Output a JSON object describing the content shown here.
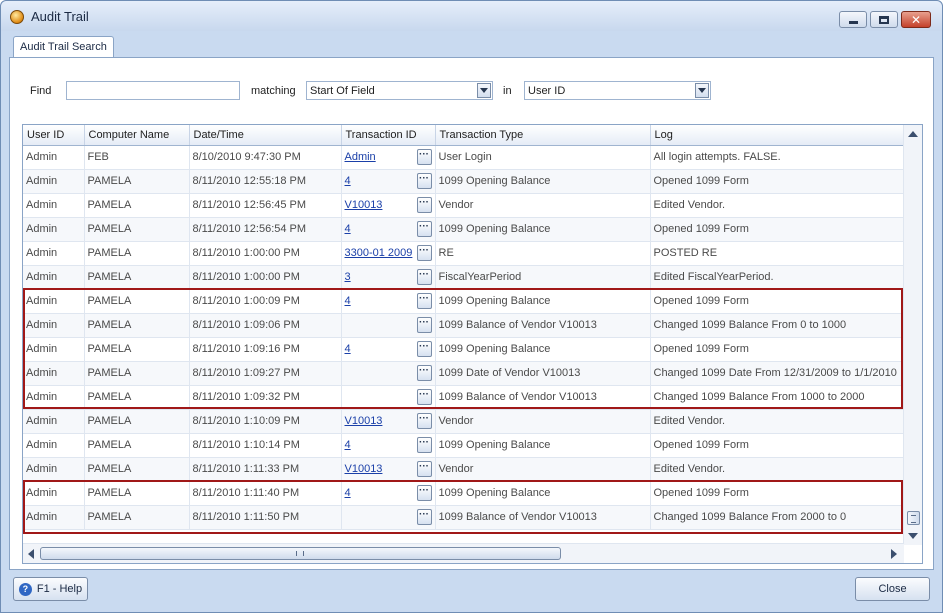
{
  "window": {
    "title": "Audit Trail"
  },
  "tabs": [
    {
      "label": "Audit Trail Search"
    }
  ],
  "search": {
    "find_label": "Find",
    "find_value": "",
    "matching_label": "matching",
    "matching_value": "Start Of Field",
    "in_label": "in",
    "in_value": "User ID"
  },
  "grid": {
    "columns": [
      "User ID",
      "Computer Name",
      "Date/Time",
      "Transaction ID",
      "Transaction Type",
      "Log"
    ],
    "rows": [
      {
        "user": "Admin",
        "computer": "FEB",
        "datetime": "8/10/2010 9:47:30 PM",
        "txid": "Admin",
        "type": "User Login",
        "log": "All login attempts. FALSE."
      },
      {
        "user": "Admin",
        "computer": "PAMELA",
        "datetime": "8/11/2010 12:55:18 PM",
        "txid": "4",
        "type": "1099 Opening Balance",
        "log": "Opened 1099 Form"
      },
      {
        "user": "Admin",
        "computer": "PAMELA",
        "datetime": "8/11/2010 12:56:45 PM",
        "txid": "V10013",
        "type": "Vendor",
        "log": "Edited Vendor."
      },
      {
        "user": "Admin",
        "computer": "PAMELA",
        "datetime": "8/11/2010 12:56:54 PM",
        "txid": "4",
        "type": "1099 Opening Balance",
        "log": "Opened 1099 Form"
      },
      {
        "user": "Admin",
        "computer": "PAMELA",
        "datetime": "8/11/2010 1:00:00 PM",
        "txid": "3300-01 2009",
        "type": "RE",
        "log": "POSTED RE"
      },
      {
        "user": "Admin",
        "computer": "PAMELA",
        "datetime": "8/11/2010 1:00:00 PM",
        "txid": "3",
        "type": "FiscalYearPeriod",
        "log": "Edited FiscalYearPeriod."
      },
      {
        "user": "Admin",
        "computer": "PAMELA",
        "datetime": "8/11/2010 1:00:09 PM",
        "txid": "4",
        "type": "1099 Opening Balance",
        "log": "Opened 1099 Form"
      },
      {
        "user": "Admin",
        "computer": "PAMELA",
        "datetime": "8/11/2010 1:09:06 PM",
        "txid": "",
        "type": "1099 Balance of Vendor V10013",
        "log": "Changed 1099 Balance From 0 to 1000"
      },
      {
        "user": "Admin",
        "computer": "PAMELA",
        "datetime": "8/11/2010 1:09:16 PM",
        "txid": "4",
        "type": "1099 Opening Balance",
        "log": "Opened 1099 Form"
      },
      {
        "user": "Admin",
        "computer": "PAMELA",
        "datetime": "8/11/2010 1:09:27 PM",
        "txid": "",
        "type": "1099 Date of Vendor V10013",
        "log": "Changed 1099 Date From 12/31/2009 to 1/1/2010"
      },
      {
        "user": "Admin",
        "computer": "PAMELA",
        "datetime": "8/11/2010 1:09:32 PM",
        "txid": "",
        "type": "1099 Balance of Vendor V10013",
        "log": "Changed 1099 Balance From 1000 to 2000"
      },
      {
        "user": "Admin",
        "computer": "PAMELA",
        "datetime": "8/11/2010 1:10:09 PM",
        "txid": "V10013",
        "type": "Vendor",
        "log": "Edited Vendor."
      },
      {
        "user": "Admin",
        "computer": "PAMELA",
        "datetime": "8/11/2010 1:10:14 PM",
        "txid": "4",
        "type": "1099 Opening Balance",
        "log": "Opened 1099 Form"
      },
      {
        "user": "Admin",
        "computer": "PAMELA",
        "datetime": "8/11/2010 1:11:33 PM",
        "txid": "V10013",
        "type": "Vendor",
        "log": "Edited Vendor."
      },
      {
        "user": "Admin",
        "computer": "PAMELA",
        "datetime": "8/11/2010 1:11:40 PM",
        "txid": "4",
        "type": "1099 Opening Balance",
        "log": "Opened 1099 Form"
      },
      {
        "user": "Admin",
        "computer": "PAMELA",
        "datetime": "8/11/2010 1:11:50 PM",
        "txid": "",
        "type": "1099 Balance of Vendor V10013",
        "log": "Changed 1099 Balance From 2000 to 0"
      }
    ],
    "ellipsis_label": "···"
  },
  "footer": {
    "help_label": "F1 - Help",
    "close_label": "Close"
  },
  "icons": {
    "app": "app-icon",
    "minimize": "minimize-icon",
    "maximize": "maximize-icon",
    "close": "close-icon",
    "dropdown": "chevron-down-icon",
    "help": "help-icon"
  },
  "colors": {
    "highlight": "#a01818",
    "link": "#1a3fa8",
    "window_frame": "#c9daf0"
  }
}
